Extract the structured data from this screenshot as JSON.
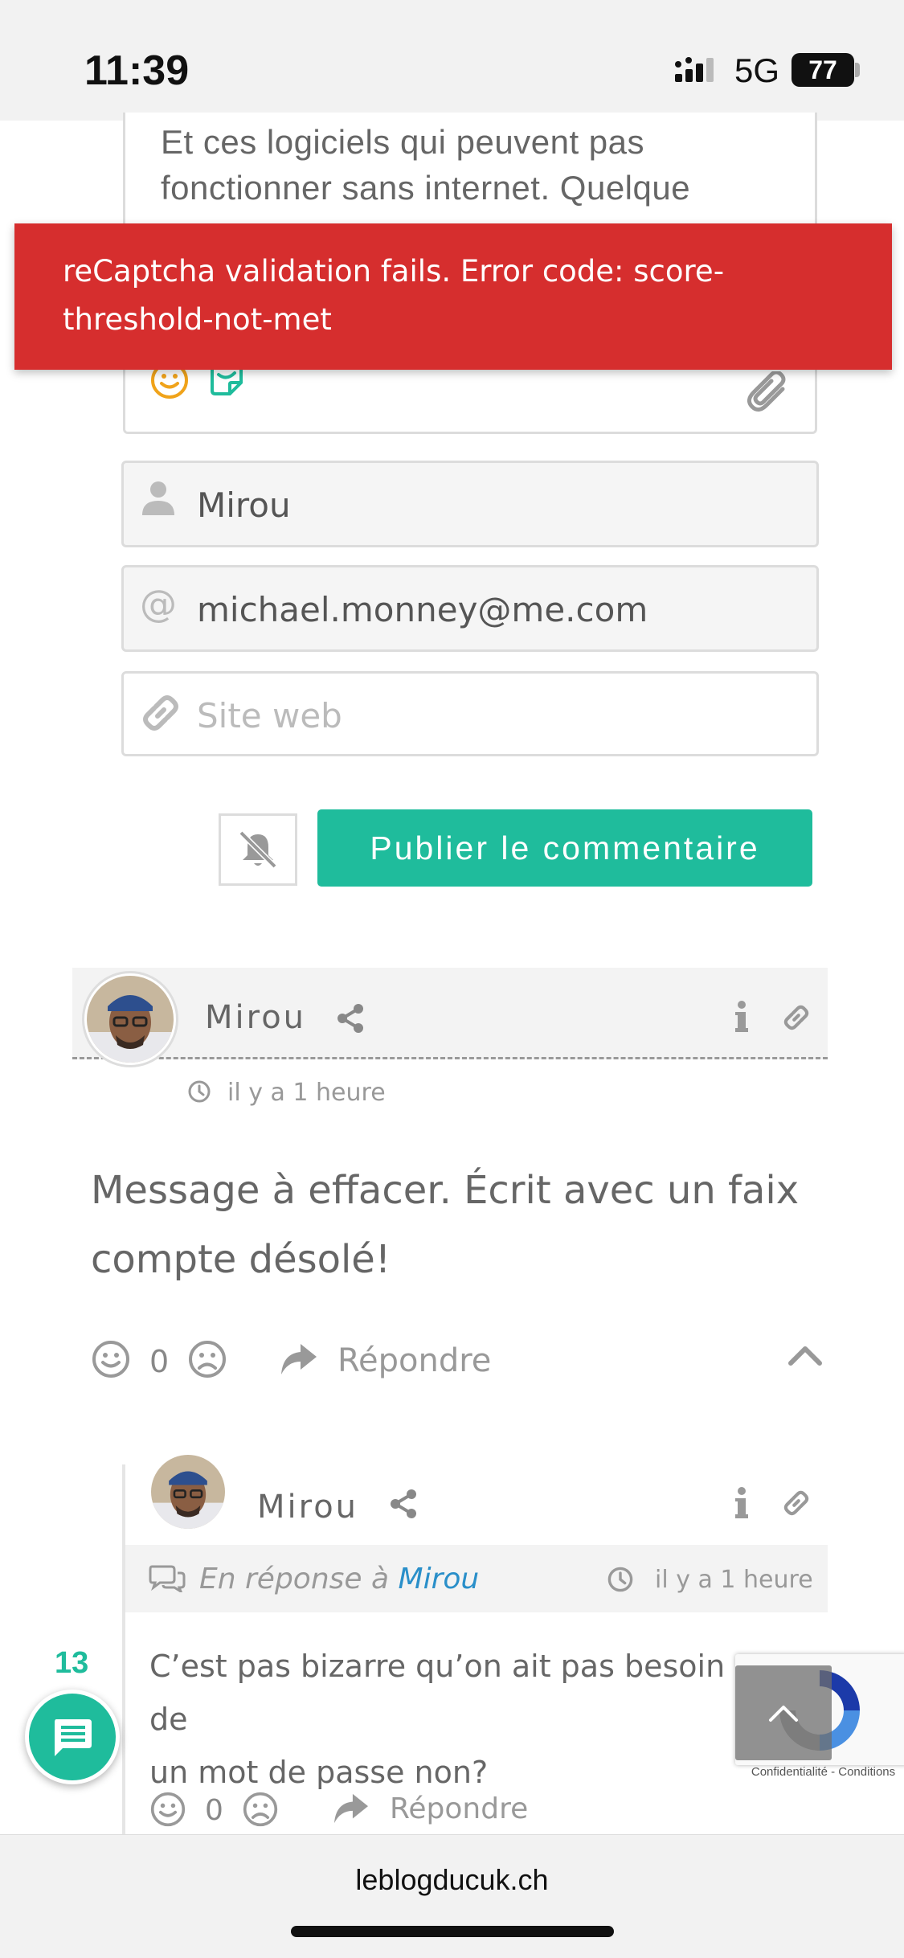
{
  "status_bar": {
    "time": "11:39",
    "network": "5G",
    "battery": "77"
  },
  "comment_form": {
    "textarea_text": "Et ces logiciels qui peuvent pas fonctionner sans internet. Quelque",
    "name_value": "Mirou",
    "email_value": "michael.monney@me.com",
    "website_placeholder": "Site web",
    "publish_label": "Publier le commentaire"
  },
  "error_toast": {
    "message": "reCaptcha validation fails. Error code: score-threshold-not-met"
  },
  "comments": [
    {
      "author": "Mirou",
      "time": "il y a 1 heure",
      "body": "Message à effacer. Écrit avec un faix compte désolé!",
      "votes": "0",
      "reply_label": "Répondre"
    },
    {
      "author": "Mirou",
      "in_reply_prefix": "En réponse à",
      "in_reply_to": "Mirou",
      "time": "il y a 1 heure",
      "body": "C’est pas bizarre qu’on ait pas besoin de",
      "body_line2": "un mot de passe non?",
      "votes": "0",
      "reply_label": "Répondre"
    }
  ],
  "floating_bubble": {
    "count": "13"
  },
  "recaptcha": {
    "links": "Confidentialité - Conditions"
  },
  "browser": {
    "url": "leblogducuk.ch"
  },
  "colors": {
    "accent": "#1fbc9c",
    "error": "#d62e2e",
    "link": "#2a8fc9"
  },
  "icons": [
    "emoji-icon",
    "sticker-icon",
    "paperclip-icon",
    "user-icon",
    "at-icon",
    "link-icon",
    "bell-off-icon",
    "share-icon",
    "info-icon",
    "clock-icon",
    "smile-icon",
    "frown-icon",
    "reply-arrow-icon",
    "chevron-up-icon",
    "comments-icon",
    "chat-bubble-icon"
  ]
}
